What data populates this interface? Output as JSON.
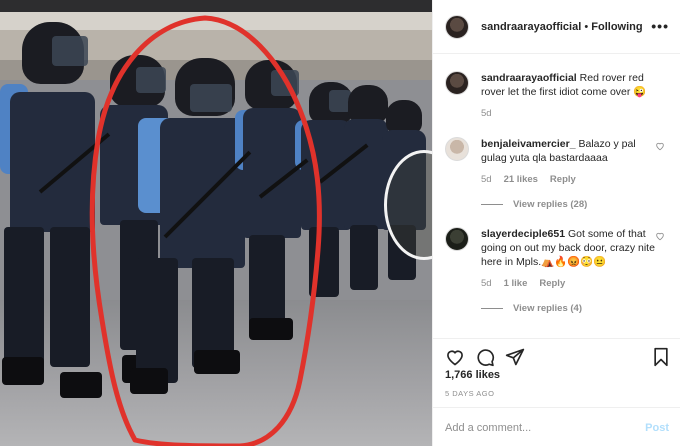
{
  "post": {
    "image_alt": "Police officers in riot gear standing in a line",
    "author": {
      "username": "sandraarayaofficial",
      "separator": "•",
      "follow_status": "Following"
    },
    "caption": {
      "username": "sandraarayaofficial",
      "text": "Red rover red rover let the first idiot come over 😜",
      "age": "5d"
    },
    "comments": [
      {
        "username": "benjaleivamercier_",
        "text": "Balazo y pal gulag yuta qla bastardaaaa",
        "age": "5d",
        "likes": "21 likes",
        "reply_label": "Reply",
        "view_replies": "View replies (28)"
      },
      {
        "username": "slayerdeciple651",
        "text": "Got some of that going on out my back door, crazy nite here in Mpls.⛺🔥😡😳😐",
        "age": "5d",
        "likes": "1 like",
        "reply_label": "Reply",
        "view_replies": "View replies (4)"
      }
    ],
    "likes_count": "1,766 likes",
    "date": "5 DAYS AGO",
    "comment_input": {
      "placeholder": "Add a comment...",
      "value": ""
    },
    "post_button": "Post",
    "icons": {
      "more": "more-icon",
      "like": "heart-icon",
      "comment": "comment-icon",
      "share": "share-icon",
      "save": "bookmark-icon",
      "comment_like": "small-heart-icon"
    },
    "colors": {
      "annotation_red": "#e0322b",
      "post_button": "#b2dffc",
      "muted_text": "#8e8e8e"
    }
  }
}
